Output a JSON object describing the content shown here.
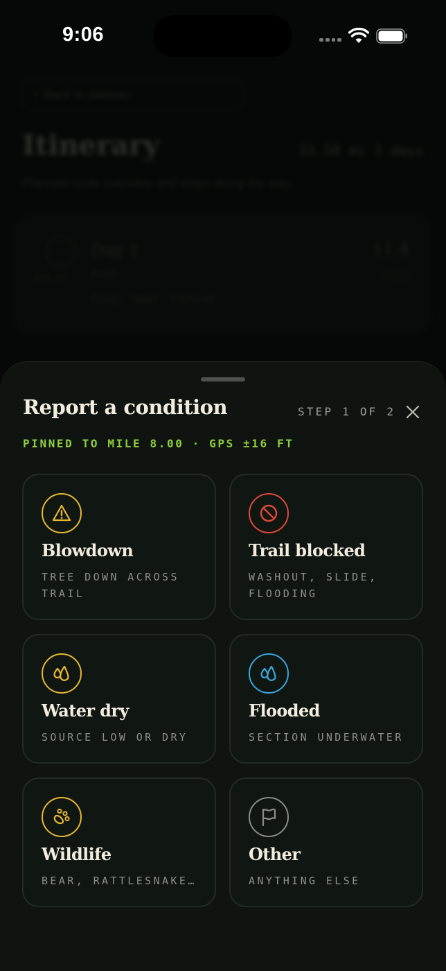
{
  "status_bar": {
    "time": "9:06"
  },
  "background": {
    "back_label": "< Back to planner",
    "title": "Itinerary",
    "stats": "33.50 mi  3 days",
    "subtitle": "Planned route overview and stops along the way",
    "day": {
      "title": "Day 1",
      "date": "Sep 14",
      "subtitle": "Route",
      "miles": "11.4",
      "elevation": "+2,110",
      "meta": "Camp  ·  Water  ·  Trailhead"
    }
  },
  "sheet": {
    "title": "Report a condition",
    "step": "STEP 1 OF 2",
    "pinned": "PINNED TO MILE 8.00 · GPS ±16 FT",
    "options": [
      {
        "title": "Blowdown",
        "description": "TREE DOWN ACROSS\nTRAIL",
        "icon": "warning-triangle-icon",
        "color": "#e8b930"
      },
      {
        "title": "Trail blocked",
        "description": "WASHOUT, SLIDE,\nFLOODING",
        "icon": "no-entry-icon",
        "color": "#e0493a"
      },
      {
        "title": "Water dry",
        "description": "SOURCE LOW OR DRY",
        "icon": "droplets-icon",
        "color": "#e8b930"
      },
      {
        "title": "Flooded",
        "description": "SECTION UNDERWATER",
        "icon": "droplets-icon",
        "color": "#3aa7e0"
      },
      {
        "title": "Wildlife",
        "description": "BEAR, RATTLESNAKE…",
        "icon": "paw-print-icon",
        "color": "#e8b930"
      },
      {
        "title": "Other",
        "description": "ANYTHING ELSE",
        "icon": "flag-icon",
        "color": "#8a8e88"
      }
    ]
  }
}
